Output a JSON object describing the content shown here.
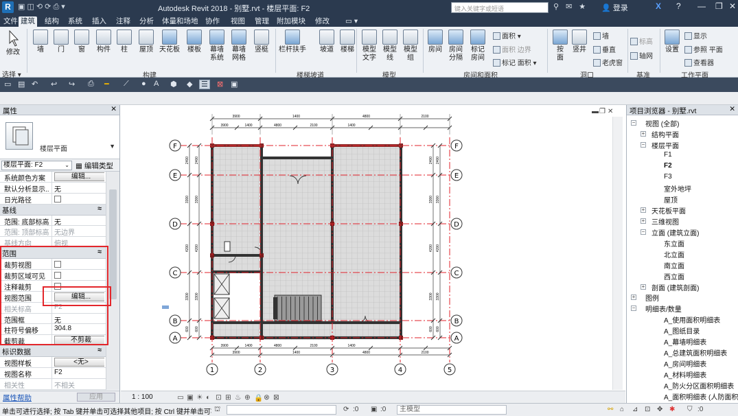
{
  "window": {
    "title": "Autodesk Revit 2018 -    别墅.rvt - 楼层平面: F2",
    "search_placeholder": "键入关键字或短语",
    "login": "登录",
    "app_logo": "R"
  },
  "menu": {
    "tabs": [
      "文件",
      "建筑",
      "结构",
      "系统",
      "插入",
      "注释",
      "分析",
      "体量和场地",
      "协作",
      "视图",
      "管理",
      "附加模块",
      "修改"
    ]
  },
  "ribbon": {
    "modify": "修改",
    "select": "选择 ▾",
    "build": [
      "墙",
      "门",
      "窗",
      "构件",
      "柱",
      "屋顶",
      "天花板",
      "楼板",
      "幕墙\n系统",
      "幕墙\n网格",
      "竖梃"
    ],
    "build_group": "构建",
    "stairs": [
      "栏杆扶手",
      "坡道",
      "楼梯"
    ],
    "stairs_group": "楼梯坡道",
    "model": [
      "模型\n文字",
      "模型\n线",
      "模型\n组"
    ],
    "model_group": "模型",
    "room": [
      "房间",
      "房间\n分隔",
      "标记\n房间"
    ],
    "room_small": [
      "面积 ▾",
      "面积 边界",
      "标记 面积 ▾"
    ],
    "room_group": "房间和面积",
    "opening": [
      "按\n面",
      "竖井"
    ],
    "opening_small": [
      "墙",
      "垂直",
      "老虎窗"
    ],
    "opening_group": "洞口",
    "datum_small": [
      "标高",
      "轴网"
    ],
    "datum_group": "基准",
    "work": [
      "设置"
    ],
    "work_small": [
      "显示",
      "参照 平面",
      "查看器"
    ],
    "work_group": "工作平面"
  },
  "properties": {
    "title": "属性",
    "type_name": "楼层平面",
    "instance_selector": "楼层平面: F2",
    "edit_type": "编辑类型",
    "rows": [
      {
        "k": "系统颜色方案",
        "v": "编辑...",
        "kind": "btn"
      },
      {
        "k": "默认分析显示...",
        "v": "无"
      },
      {
        "k": "日光路径",
        "v": "",
        "kind": "chk"
      },
      {
        "group": "基线"
      },
      {
        "k": "范围: 底部标高",
        "v": "无"
      },
      {
        "k": "范围: 顶部标高",
        "v": "无边界",
        "kind": "dis"
      },
      {
        "k": "基线方向",
        "v": "俯视",
        "kind": "dis"
      },
      {
        "group": "范围"
      },
      {
        "k": "裁剪视图",
        "v": "",
        "kind": "chk"
      },
      {
        "k": "裁剪区域可见",
        "v": "",
        "kind": "chk"
      },
      {
        "k": "注释裁剪",
        "v": "",
        "kind": "chk"
      },
      {
        "k": "视图范围",
        "v": "编辑...",
        "kind": "btn"
      },
      {
        "k": "相关标高",
        "v": "F2",
        "kind": "dis"
      },
      {
        "k": "范围框",
        "v": "无"
      },
      {
        "k": "柱符号偏移",
        "v": "304.8"
      },
      {
        "k": "截剪裁",
        "v": "不剪裁",
        "kind": "btn"
      },
      {
        "group": "标识数据"
      },
      {
        "k": "视图样板",
        "v": "<无>",
        "kind": "btn"
      },
      {
        "k": "视图名称",
        "v": "F2"
      },
      {
        "k": "相关性",
        "v": "不相关",
        "kind": "dis"
      }
    ],
    "help_link": "属性帮助",
    "apply": "应用"
  },
  "plan": {
    "grids_v": [
      "1",
      "2",
      "3",
      "4",
      "5"
    ],
    "grids_h": [
      "F",
      "E",
      "D",
      "C",
      "B",
      "A"
    ],
    "dims_top": [
      "3900",
      "1400",
      "4800",
      "2100",
      "1400"
    ],
    "dims_bottom": [
      "3900",
      "1400",
      "4800",
      "2100",
      "1400"
    ],
    "dims_left": [
      "2400",
      "3300",
      "4200",
      "3300",
      "600"
    ],
    "dims_right": [
      "2400",
      "3300",
      "4200",
      "3300",
      "600"
    ]
  },
  "view_control": {
    "scale": "1 : 100"
  },
  "browser": {
    "title": "项目浏览器 - 别墅.rvt",
    "nodes": [
      {
        "t": "视图 (全部)",
        "lvl": 0,
        "ex": "−"
      },
      {
        "t": "结构平面",
        "lvl": 1,
        "ex": "+"
      },
      {
        "t": "楼层平面",
        "lvl": 1,
        "ex": "−"
      },
      {
        "t": "F1",
        "lvl": 2
      },
      {
        "t": "F2",
        "lvl": 2,
        "bold": true
      },
      {
        "t": "F3",
        "lvl": 2
      },
      {
        "t": "室外地坪",
        "lvl": 2
      },
      {
        "t": "屋顶",
        "lvl": 2
      },
      {
        "t": "天花板平面",
        "lvl": 1,
        "ex": "+"
      },
      {
        "t": "三维视图",
        "lvl": 1,
        "ex": "+"
      },
      {
        "t": "立面 (建筑立面)",
        "lvl": 1,
        "ex": "−"
      },
      {
        "t": "东立面",
        "lvl": 2
      },
      {
        "t": "北立面",
        "lvl": 2
      },
      {
        "t": "南立面",
        "lvl": 2
      },
      {
        "t": "西立面",
        "lvl": 2
      },
      {
        "t": "剖面 (建筑剖面)",
        "lvl": 1,
        "ex": "+"
      },
      {
        "t": "图例",
        "lvl": 0,
        "ex": "+"
      },
      {
        "t": "明细表/数量",
        "lvl": 0,
        "ex": "−"
      },
      {
        "t": "A_使用面积明细表",
        "lvl": 2
      },
      {
        "t": "A_图纸目录",
        "lvl": 2
      },
      {
        "t": "A_幕墙明细表",
        "lvl": 2
      },
      {
        "t": "A_总建筑面积明细表",
        "lvl": 2
      },
      {
        "t": "A_房间明细表",
        "lvl": 2
      },
      {
        "t": "A_材料明细表",
        "lvl": 2
      },
      {
        "t": "A_防火分区面积明细表",
        "lvl": 2
      },
      {
        "t": "A_面积明细表 (人防面积)",
        "lvl": 2
      }
    ]
  },
  "status": {
    "text": "单击可进行选择; 按 Tab 键并单击可选择其他项目; 按 Ctrl 键并单击可将新项目添加到选择集",
    "zero1": ":0",
    "zero2": ":0",
    "model": "主模型",
    "filter": ":0"
  }
}
